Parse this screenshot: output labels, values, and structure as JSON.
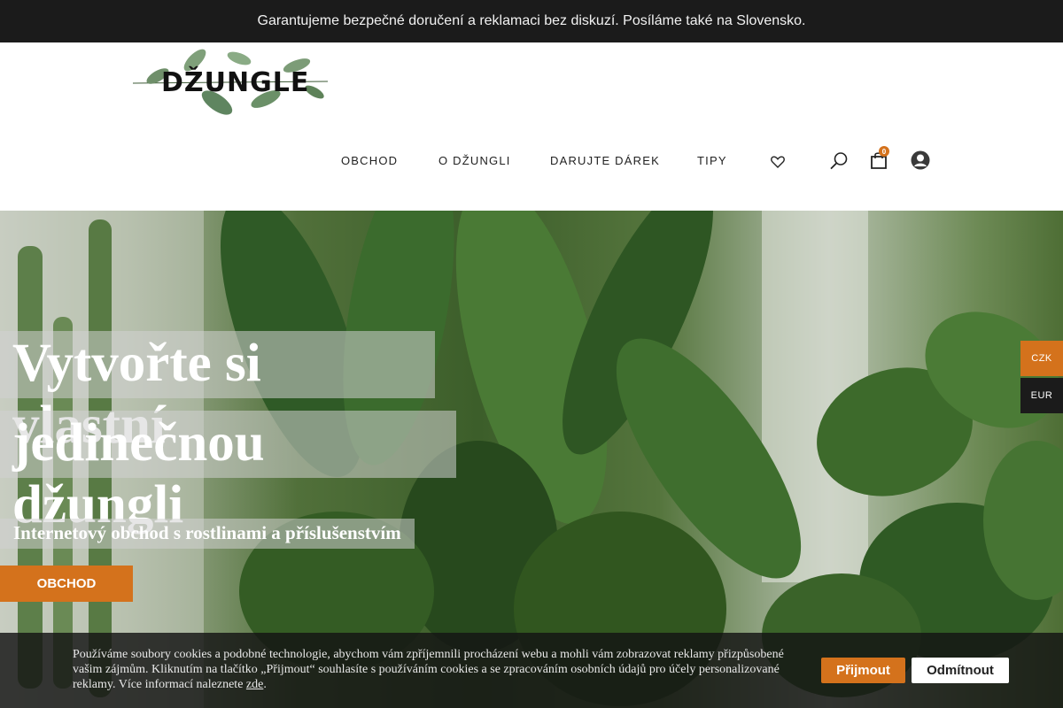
{
  "announcement": "Garantujeme bezpečné doručení a reklamaci bez diskuzí. Posíláme také na Slovensko.",
  "logo": {
    "text": "DŽUNGLE"
  },
  "nav": {
    "items": [
      {
        "label": "OBCHOD"
      },
      {
        "label": "O DŽUNGLI"
      },
      {
        "label": "DARUJTE DÁREK"
      },
      {
        "label": "TIPY"
      }
    ],
    "icons": {
      "wishlist": "heart-icon",
      "search": "search-icon",
      "cart": "shopping-bag-icon",
      "account": "user-icon"
    },
    "cart_count": "0"
  },
  "hero": {
    "title_line1": "Vytvořte si vlastní",
    "title_line2": "jedinečnou džungli",
    "subtitle": "Internetový obchod s rostlinami a příslušenstvím",
    "cta": "OBCHOD"
  },
  "currency": {
    "options": [
      "CZK",
      "EUR"
    ],
    "selected": "CZK"
  },
  "cookie": {
    "text": "Používáme soubory cookies a podobné technologie, abychom vám zpříjemnili procházení webu a mohli vám zobrazovat reklamy přizpůsobené vašim zájmům. Kliknutím na tlačítko „Přijmout“ souhlasíte s používáním cookies a se zpracováním osobních údajů pro účely personalizované reklamy. Více informací naleznete",
    "link": "zde",
    "accept": "Přijmout",
    "reject": "Odmítnout"
  },
  "colors": {
    "accent": "#d4721c",
    "topbar": "#1b1b1b",
    "currency_active": "#d4721c",
    "currency_inactive": "#1b1b1b"
  }
}
